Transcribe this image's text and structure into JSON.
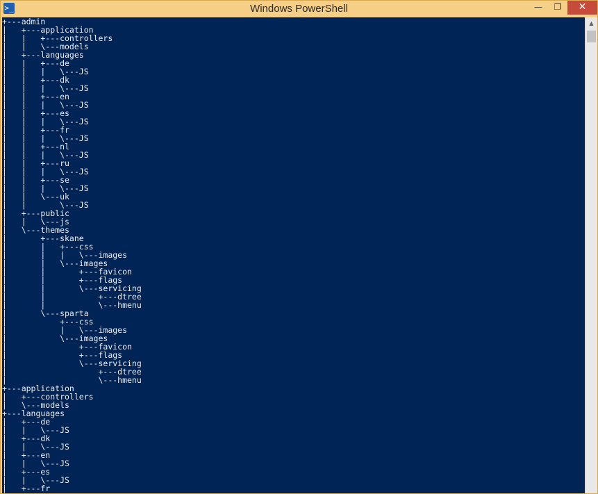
{
  "window": {
    "title": "Windows PowerShell",
    "icon": "powershell-icon",
    "controls": {
      "minimize": "minimize-icon",
      "maximize": "maximize-icon",
      "close": "close-icon"
    }
  },
  "console": {
    "lines": [
      "+---admin",
      "|   +---application",
      "|   |   +---controllers",
      "|   |   \\---models",
      "|   +---languages",
      "|   |   +---de",
      "|   |   |   \\---JS",
      "|   |   +---dk",
      "|   |   |   \\---JS",
      "|   |   +---en",
      "|   |   |   \\---JS",
      "|   |   +---es",
      "|   |   |   \\---JS",
      "|   |   +---fr",
      "|   |   |   \\---JS",
      "|   |   +---nl",
      "|   |   |   \\---JS",
      "|   |   +---ru",
      "|   |   |   \\---JS",
      "|   |   +---se",
      "|   |   |   \\---JS",
      "|   |   \\---uk",
      "|   |       \\---JS",
      "|   +---public",
      "|   |   \\---js",
      "|   \\---themes",
      "|       +---skane",
      "|       |   +---css",
      "|       |   |   \\---images",
      "|       |   \\---images",
      "|       |       +---favicon",
      "|       |       +---flags",
      "|       |       \\---servicing",
      "|       |           +---dtree",
      "|       |           \\---hmenu",
      "|       \\---sparta",
      "|           +---css",
      "|           |   \\---images",
      "|           \\---images",
      "|               +---favicon",
      "|               +---flags",
      "|               \\---servicing",
      "|                   +---dtree",
      "|                   \\---hmenu",
      "+---application",
      "|   +---controllers",
      "|   \\---models",
      "+---languages",
      "|   +---de",
      "|   |   \\---JS",
      "|   +---dk",
      "|   |   \\---JS",
      "|   +---en",
      "|   |   \\---JS",
      "|   +---es",
      "|   |   \\---JS",
      "|   +---fr"
    ]
  },
  "scrollbar": {
    "up_arrow": "scroll-up-arrow-icon",
    "position_fraction": 0.0
  }
}
